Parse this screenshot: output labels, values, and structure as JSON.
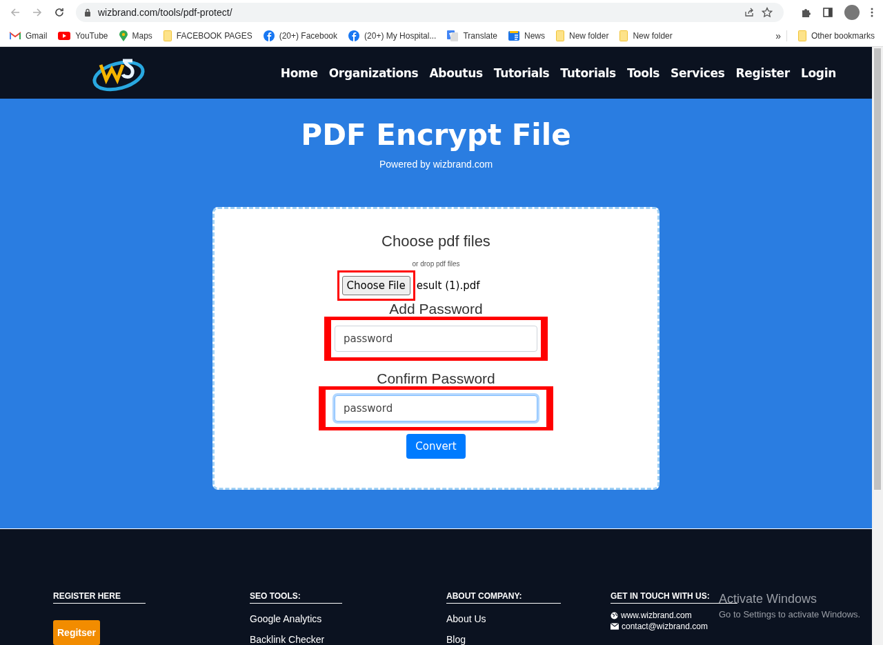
{
  "browser": {
    "url": "wizbrand.com/tools/pdf-protect/",
    "bookmarks": [
      {
        "kind": "gmail",
        "label": "Gmail"
      },
      {
        "kind": "youtube",
        "label": "YouTube"
      },
      {
        "kind": "maps",
        "label": "Maps"
      },
      {
        "kind": "folder",
        "label": "FACEBOOK PAGES"
      },
      {
        "kind": "facebook",
        "label": "(20+) Facebook"
      },
      {
        "kind": "facebook",
        "label": "(20+) My Hospital..."
      },
      {
        "kind": "translate",
        "label": "Translate"
      },
      {
        "kind": "news",
        "label": "News"
      },
      {
        "kind": "folder",
        "label": "New folder"
      },
      {
        "kind": "folder",
        "label": "New folder"
      }
    ],
    "overflow": "»",
    "other_bookmarks": "Other bookmarks"
  },
  "nav": {
    "items": [
      "Home",
      "Organizations",
      "Aboutus",
      "Tutorials",
      "Tutorials",
      "Tools",
      "Services",
      "Register",
      "Login"
    ]
  },
  "hero": {
    "title": "PDF Encrypt File",
    "subtitle": "Powered by wizbrand.com"
  },
  "form": {
    "choose_label": "Choose pdf files",
    "drop_hint": "or drop pdf files",
    "file_button": "Choose File",
    "file_name": "esult (1).pdf",
    "fields": [
      {
        "label": "Add Password",
        "placeholder": "password",
        "focused": false
      },
      {
        "label": "Confirm Password",
        "placeholder": "password",
        "focused": true
      }
    ],
    "submit": "Convert"
  },
  "footer": {
    "columns": [
      {
        "kind": "button",
        "heading": "REGISTER HERE",
        "button": "Regitser"
      },
      {
        "kind": "links",
        "heading": "SEO TOOLS:",
        "links": [
          "Google Analytics",
          "Backlink Checker"
        ]
      },
      {
        "kind": "links",
        "heading": "ABOUT COMPANY:",
        "links": [
          "About Us",
          "Blog"
        ]
      },
      {
        "kind": "contact",
        "heading": "GET IN TOUCH WITH US:",
        "website": "www.wizbrand.com",
        "email": "contact@wizbrand.com"
      }
    ]
  },
  "os_notice": {
    "title": "Activate Windows",
    "text": "Go to Settings to activate Windows."
  }
}
